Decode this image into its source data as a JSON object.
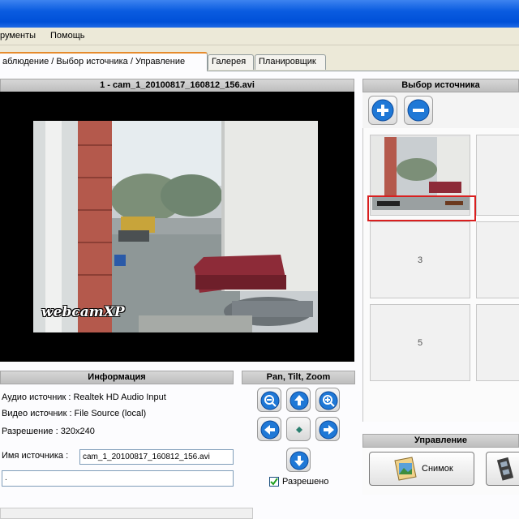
{
  "menu": {
    "items": [
      "рументы",
      "Помощь"
    ]
  },
  "tabs": [
    {
      "label": "аблюдение / Выбор источника / Управление",
      "active": true
    },
    {
      "label": "Галерея",
      "active": false
    },
    {
      "label": "Планировщик",
      "active": false
    }
  ],
  "video": {
    "title": "1 - cam_1_20100817_160812_156.avi",
    "watermark": "webcamXP"
  },
  "info": {
    "header": "Информация",
    "audio_source": "Аудио источник : Realtek HD Audio Input",
    "video_source": "Видео источник : File Source (local)",
    "resolution": "Разрешение : 320x240",
    "source_name_label": "Имя источника :",
    "source_name_value": "cam_1_20100817_160812_156.avi",
    "extra_field_value": "."
  },
  "ptz": {
    "header": "Pan, Tilt, Zoom",
    "allowed_label": "Разрешено",
    "allowed_checked": true
  },
  "sources": {
    "header": "Выбор источника",
    "tiles": [
      "",
      "",
      "3",
      "",
      "5",
      ""
    ]
  },
  "control": {
    "header": "Управление",
    "snapshot_label": "Снимок"
  }
}
